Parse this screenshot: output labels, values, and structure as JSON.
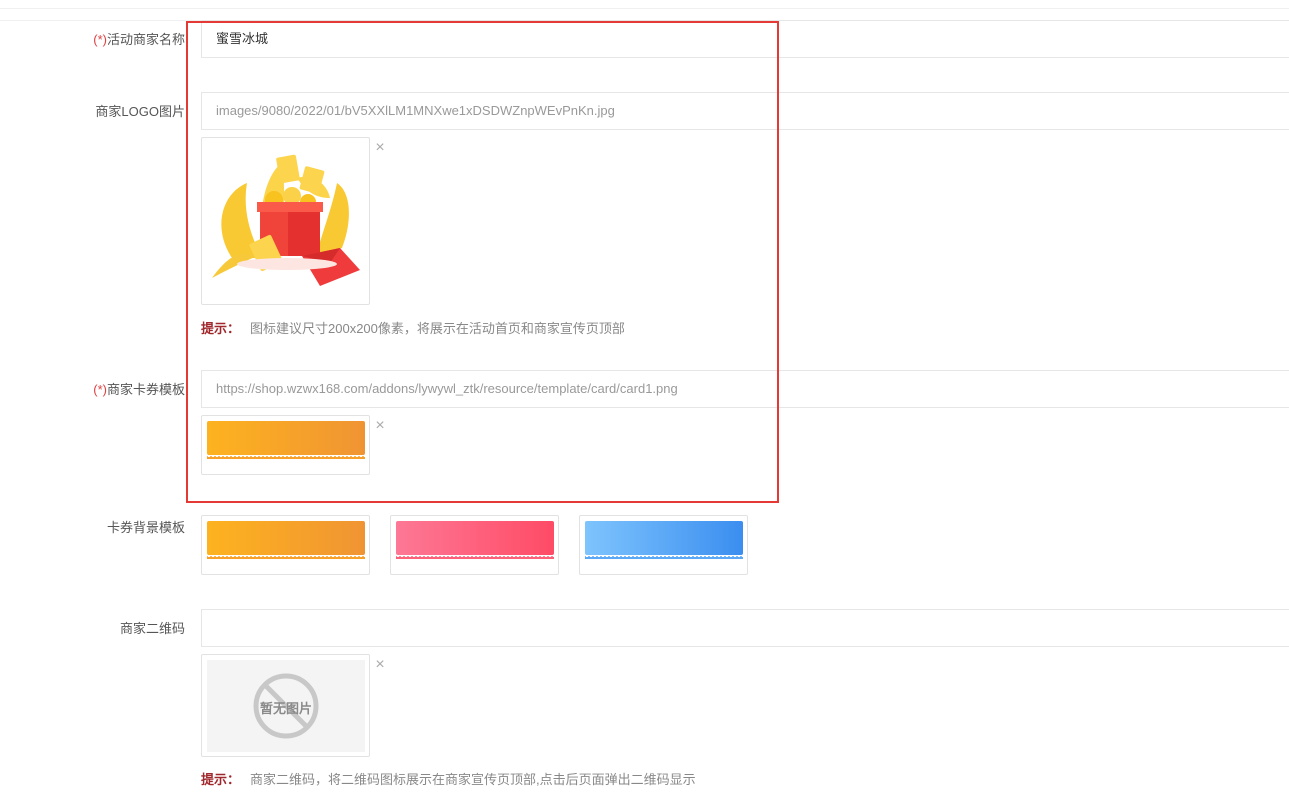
{
  "form": {
    "required_mark": "(*)",
    "merchant_name": {
      "label": "活动商家名称",
      "value": "蜜雪冰城"
    },
    "logo": {
      "label": "商家LOGO图片",
      "value": "images/9080/2022/01/bV5XXlLM1MNXwe1xDSDWZnpWEvPnKn.jpg",
      "remove_icon": "×",
      "hint_prefix": "提示：",
      "hint": "图标建议尺寸200x200像素，将展示在活动首页和商家宣传页顶部"
    },
    "coupon_template": {
      "label": "商家卡券模板",
      "value": "https://shop.wzwx168.com/addons/lywywl_ztk/resource/template/card/card1.png",
      "remove_icon": "×"
    },
    "coupon_background": {
      "label": "卡券背景模板",
      "options": [
        "orange",
        "pink",
        "blue"
      ]
    },
    "qrcode": {
      "label": "商家二维码",
      "value": "",
      "no_image_text": "暂无图片",
      "remove_icon": "×",
      "hint_prefix": "提示：",
      "hint": "商家二维码，将二维码图标展示在商家宣传页顶部,点击后页面弹出二维码显示"
    }
  },
  "colors": {
    "highlight_border": "#e53935",
    "required": "#e04040",
    "hint_prefix": "#a0282c",
    "ticket_orange": "#f7a02a",
    "ticket_pink": "#fd6079",
    "ticket_blue": "#5aa8f6"
  }
}
